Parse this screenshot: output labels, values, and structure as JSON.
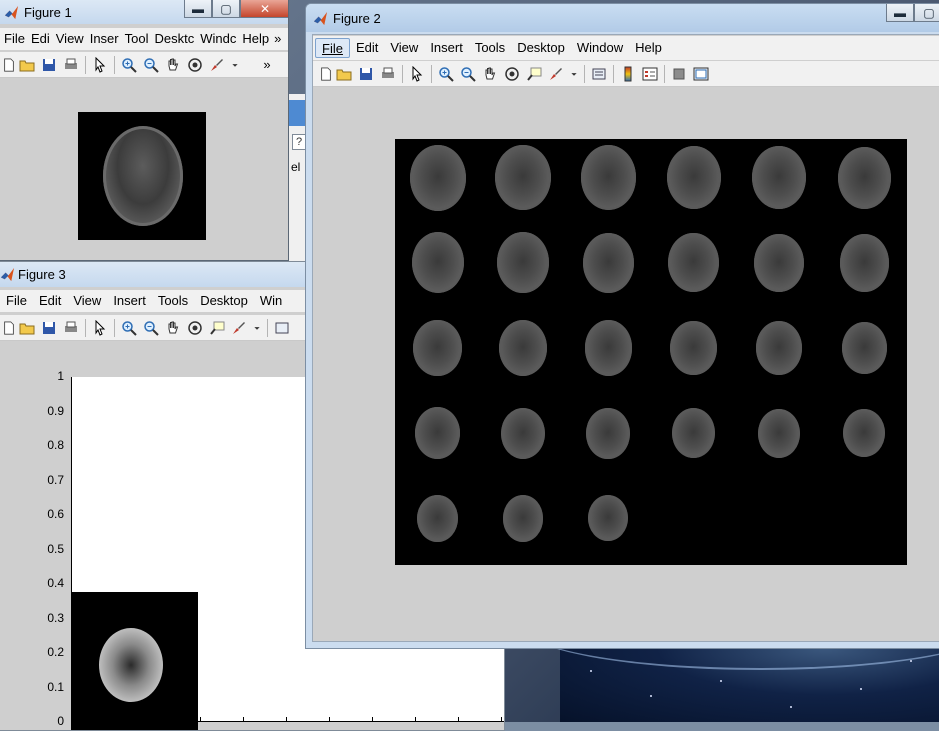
{
  "figure1": {
    "title": "Figure 1",
    "buttons": {
      "minimize": "▬",
      "maximize": "▢",
      "close": "✕"
    },
    "menus": [
      "File",
      "Edi",
      "View",
      "Inser",
      "Tool",
      "Desktc",
      "Windc",
      "Help"
    ],
    "menu_overflow": "»",
    "toolbar_overflow": "»"
  },
  "figure2": {
    "title": "Figure 2",
    "buttons": {
      "minimize": "▬",
      "maximize": "▢"
    },
    "menus": [
      "File",
      "Edit",
      "View",
      "Insert",
      "Tools",
      "Desktop",
      "Window",
      "Help"
    ]
  },
  "figure3": {
    "title": "Figure 3",
    "menus": [
      "File",
      "Edit",
      "View",
      "Insert",
      "Tools",
      "Desktop",
      "Win"
    ],
    "axis": {
      "y_ticks": [
        "1",
        "0.9",
        "0.8",
        "0.7",
        "0.6",
        "0.5",
        "0.4",
        "0.3",
        "0.2",
        "0.1",
        "0"
      ],
      "ylim": [
        0,
        1
      ]
    }
  },
  "background_window": {
    "help_glyph": "?",
    "text": "el"
  },
  "montage": {
    "rows": 5,
    "cols": 6,
    "slices": 27
  },
  "colors": {
    "titlebar": "#c9ddf2",
    "window": "#cfcfcf",
    "menubar": "#f1f1f1",
    "accent": "#7da2ce"
  }
}
